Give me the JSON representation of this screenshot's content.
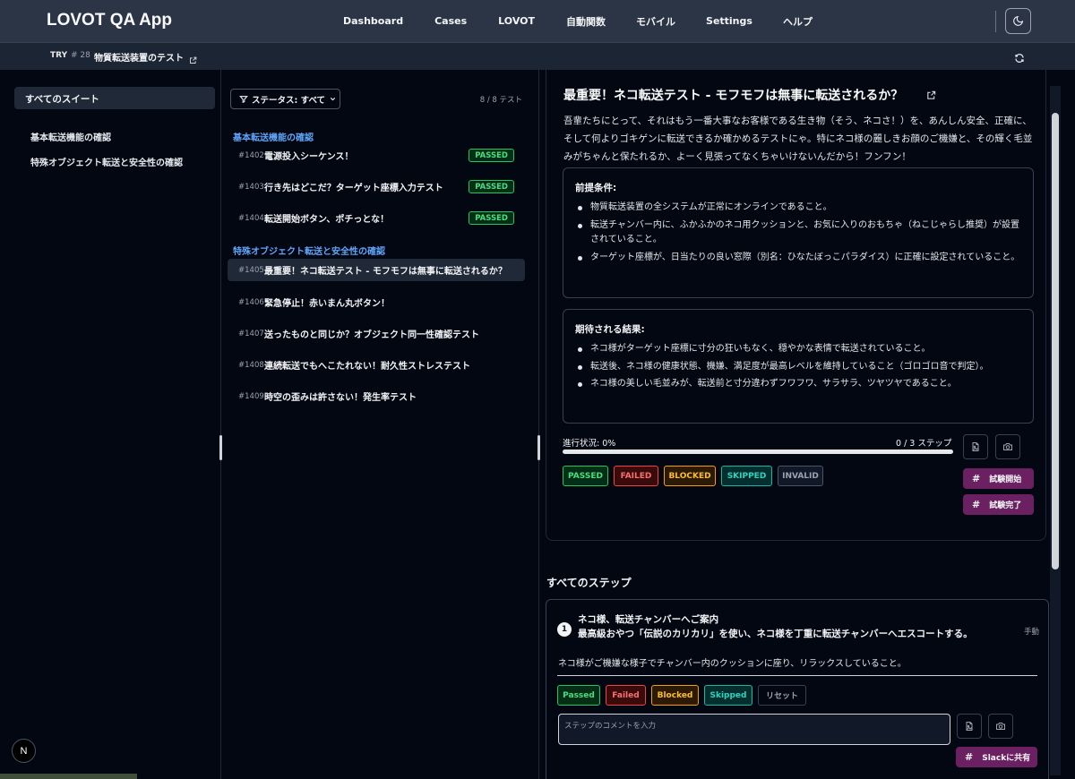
{
  "app": {
    "title": "LOVOT QA App"
  },
  "nav": {
    "items": [
      {
        "label": "Dashboard"
      },
      {
        "label": "Cases"
      },
      {
        "label": "LOVOT"
      },
      {
        "label": "自動関数"
      },
      {
        "label": "モバイル"
      },
      {
        "label": "Settings"
      },
      {
        "label": "ヘルプ"
      }
    ],
    "theme_icon": "moon-icon"
  },
  "subnav": {
    "tag": "TRY",
    "number": "# 28",
    "title": "物質転送装置のテスト",
    "refresh_icon": "refresh-icon"
  },
  "sidebar": {
    "all_suites": "すべてのスイート",
    "suites": [
      {
        "label": "基本転送機能の確認"
      },
      {
        "label": "特殊オブジェクト転送と安全性の確認"
      }
    ],
    "logo": "N"
  },
  "cases": {
    "status_filter": "ステータス: すべて",
    "count": "8 / 8 テスト",
    "groups": [
      {
        "title": "基本転送機能の確認",
        "items": [
          {
            "id": "#1402",
            "title": "電源投入シーケンス！",
            "status": "PASSED"
          },
          {
            "id": "#1403",
            "title": "行き先はどこだ？ターゲット座標入力テスト",
            "status": "PASSED"
          },
          {
            "id": "#1404",
            "title": "転送開始ボタン、ポチっとな！",
            "status": "PASSED"
          }
        ]
      },
      {
        "title": "特殊オブジェクト転送と安全性の確認",
        "items": [
          {
            "id": "#1405",
            "title": "最重要！ネコ転送テスト - モフモフは無事に転送されるか？",
            "status": ""
          },
          {
            "id": "#1406",
            "title": "緊急停止！赤いまん丸ボタン！",
            "status": ""
          },
          {
            "id": "#1407",
            "title": "送ったものと同じか？オブジェクト同一性確認テスト",
            "status": ""
          },
          {
            "id": "#1408",
            "title": "連続転送でもへこたれない！耐久性ストレステスト",
            "status": ""
          },
          {
            "id": "#1409",
            "title": "時空の歪みは許さない！発生率テスト",
            "status": ""
          }
        ]
      }
    ]
  },
  "detail": {
    "title": "最重要！ネコ転送テスト - モフモフは無事に転送されるか？",
    "description": "吾輩たちにとって、それはもう一番大事なお客様である生き物（そう、ネコさ！）を、あんしん安全、正確に、そして何よりゴキゲンに転送できるか確かめるテストにゃ。特にネコ様の麗しきお顔のご機嫌と、その輝く毛並みがちゃんと保たれるか、よーく見張ってなくちゃいけないんだから！フンフン！",
    "preconditions": {
      "heading": "前提条件:",
      "items": [
        "物質転送装置の全システムが正常にオンラインであること。",
        "転送チャンバー内に、ふかふかのネコ用クッションと、お気に入りのおもちゃ（ねこじゃらし推奨）が設置されていること。",
        "ターゲット座標が、日当たりの良い窓際（別名：ひなたぼっこパラダイス）に正確に設定されていること。"
      ]
    },
    "expected": {
      "heading": "期待される結果:",
      "items": [
        "ネコ様がターゲット座標に寸分の狂いもなく、穏やかな表情で転送されていること。",
        "転送後、ネコ様の健康状態、機嫌、満足度が最高レベルを維持していること（ゴロゴロ音で判定）。",
        "ネコ様の美しい毛並みが、転送前と寸分違わずフワフワ、サラサラ、ツヤツヤであること。"
      ]
    },
    "progress": {
      "label": "進行状況: 0%",
      "steps_text": "0 / 3 ステップ",
      "fraction": 0
    },
    "status_buttons": [
      {
        "label": "PASSED",
        "color": "#22c55e"
      },
      {
        "label": "FAILED",
        "color": "#ef4444"
      },
      {
        "label": "BLOCKED",
        "color": "#f59e0b"
      },
      {
        "label": "SKIPPED",
        "color": "#14b8a6"
      },
      {
        "label": "INVALID",
        "color": "#6b7280"
      }
    ],
    "start_label": "試験開始",
    "complete_label": "試験完了"
  },
  "steps": {
    "heading": "すべてのステップ",
    "items": [
      {
        "number": "1",
        "title": "ネコ様、転送チャンバーへご案内",
        "action": "最高級おやつ「伝説のカリカリ」を使い、ネコ様を丁重に転送チャンバーへエスコートする。",
        "mode": "手動",
        "expected": "ネコ様がご機嫌な様子でチャンバー内のクッションに座り、リラックスしていること。",
        "buttons": [
          {
            "label": "Passed",
            "color": "#22c55e"
          },
          {
            "label": "Failed",
            "color": "#ef4444"
          },
          {
            "label": "Blocked",
            "color": "#f59e0b"
          },
          {
            "label": "Skipped",
            "color": "#14b8a6"
          },
          {
            "label": "リセット",
            "color": "#6b7280"
          }
        ],
        "comment_placeholder": "ステップのコメントを入力",
        "slack_label": "Slackに共有"
      }
    ]
  }
}
